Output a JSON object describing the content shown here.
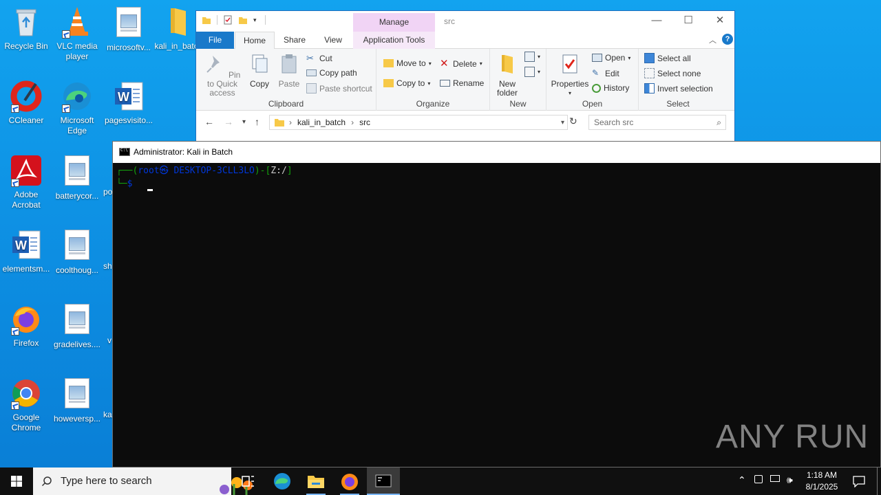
{
  "desktop": {
    "icons": [
      {
        "label": "Recycle Bin"
      },
      {
        "label": "VLC media player"
      },
      {
        "label": "microsoftv..."
      },
      {
        "label": "kali_in_batc"
      },
      {
        "label": "CCleaner"
      },
      {
        "label": "Microsoft Edge"
      },
      {
        "label": "pagesvisito..."
      },
      {
        "label": "Adobe Acrobat"
      },
      {
        "label": "batterycor..."
      },
      {
        "label": "po"
      },
      {
        "label": "elementsm..."
      },
      {
        "label": "coolthoug..."
      },
      {
        "label": "sh"
      },
      {
        "label": "Firefox"
      },
      {
        "label": "gradelives...."
      },
      {
        "label": "v"
      },
      {
        "label": "Google Chrome"
      },
      {
        "label": "howeversp..."
      },
      {
        "label": "ka"
      }
    ]
  },
  "explorer": {
    "title": "src",
    "manage_tab": "Manage",
    "tabs": {
      "file": "File",
      "home": "Home",
      "share": "Share",
      "view": "View",
      "app_tools": "Application Tools"
    },
    "clipboard": {
      "pin": "Pin to Quick access",
      "copy": "Copy",
      "paste": "Paste",
      "cut": "Cut",
      "copy_path": "Copy path",
      "paste_shortcut": "Paste shortcut",
      "group": "Clipboard"
    },
    "organize": {
      "move_to": "Move to",
      "copy_to": "Copy to",
      "delete": "Delete",
      "rename": "Rename",
      "group": "Organize"
    },
    "new": {
      "new_folder": "New folder",
      "group": "New"
    },
    "open": {
      "properties": "Properties",
      "open": "Open",
      "edit": "Edit",
      "history": "History",
      "group": "Open"
    },
    "select": {
      "select_all": "Select all",
      "select_none": "Select none",
      "invert": "Invert selection",
      "group": "Select"
    },
    "address": {
      "segment1": "kali_in_batch",
      "segment2": "src"
    },
    "search_placeholder": "Search src"
  },
  "console": {
    "title": "Administrator:  Kali in Batch",
    "prompt_prefix": "┌──(",
    "prompt_user_host": "root㉿ DESKTOP-3CLL3LO",
    "prompt_mid": ")-[",
    "prompt_path": "Z:/",
    "prompt_end": "]",
    "prompt_line2": "└─",
    "prompt_symbol": "$"
  },
  "watermark": "ANY RUN",
  "taskbar": {
    "search_placeholder": "Type here to search",
    "time": "1:18 AM",
    "date": "8/1/2025"
  },
  "colors": {
    "desktop_blue": "#0f8fe0",
    "console_green": "#13a10e",
    "console_blue": "#0037da",
    "ribbon_file": "#1979ca",
    "manage_pink": "#f1d4f5"
  }
}
